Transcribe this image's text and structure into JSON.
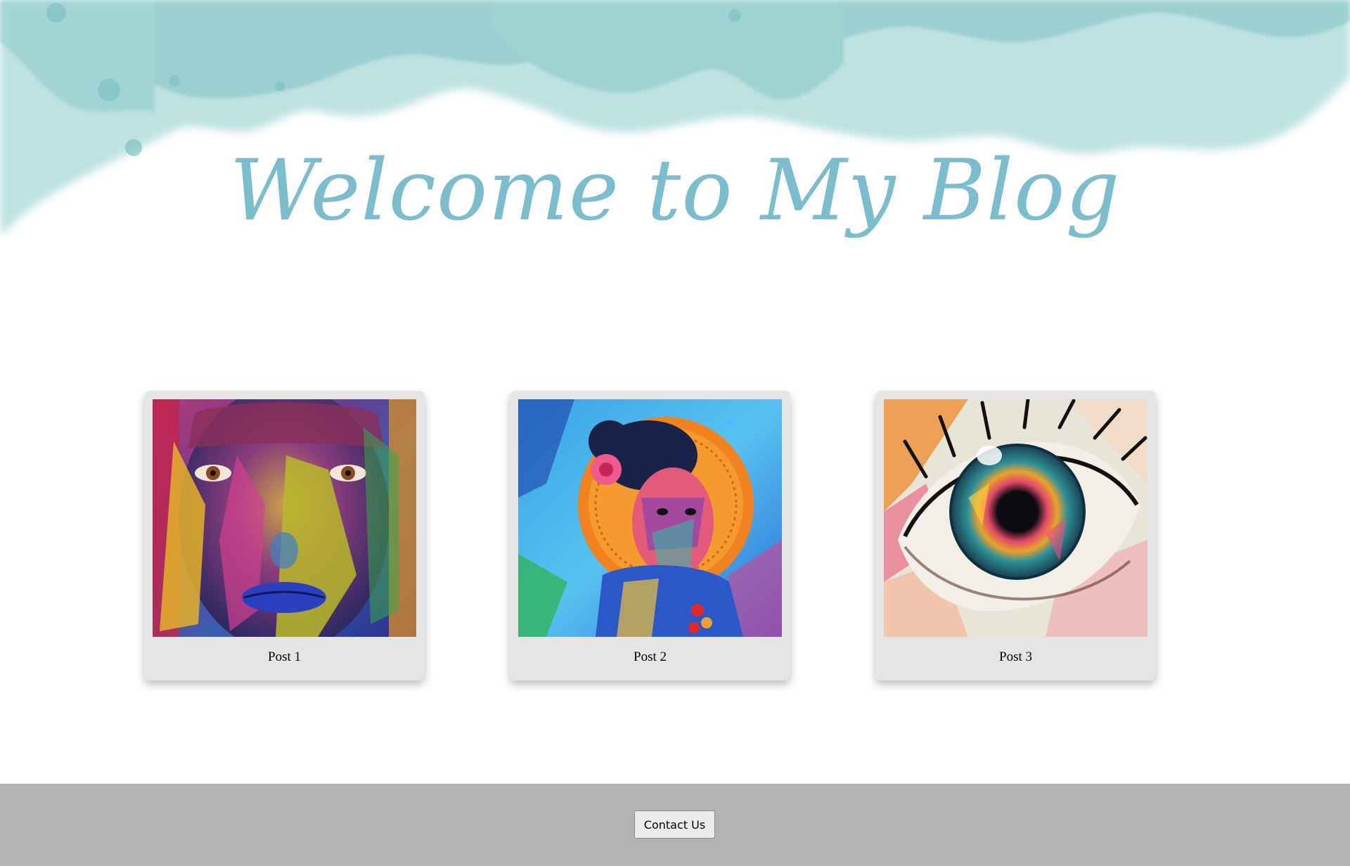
{
  "header": {
    "title": "Welcome to My Blog"
  },
  "posts": [
    {
      "title": "Post 1",
      "image": "colorful-painted-face-image"
    },
    {
      "title": "Post 2",
      "image": "colorful-woman-portrait-mural-image"
    },
    {
      "title": "Post 3",
      "image": "colorful-eye-painting-image"
    }
  ],
  "footer": {
    "contact_label": "Contact Us"
  },
  "colors": {
    "title": "#7bbccd",
    "watercolor": "#9fd3d4",
    "card_bg": "#e5e5e5",
    "footer_bg": "#b3b3b3"
  }
}
